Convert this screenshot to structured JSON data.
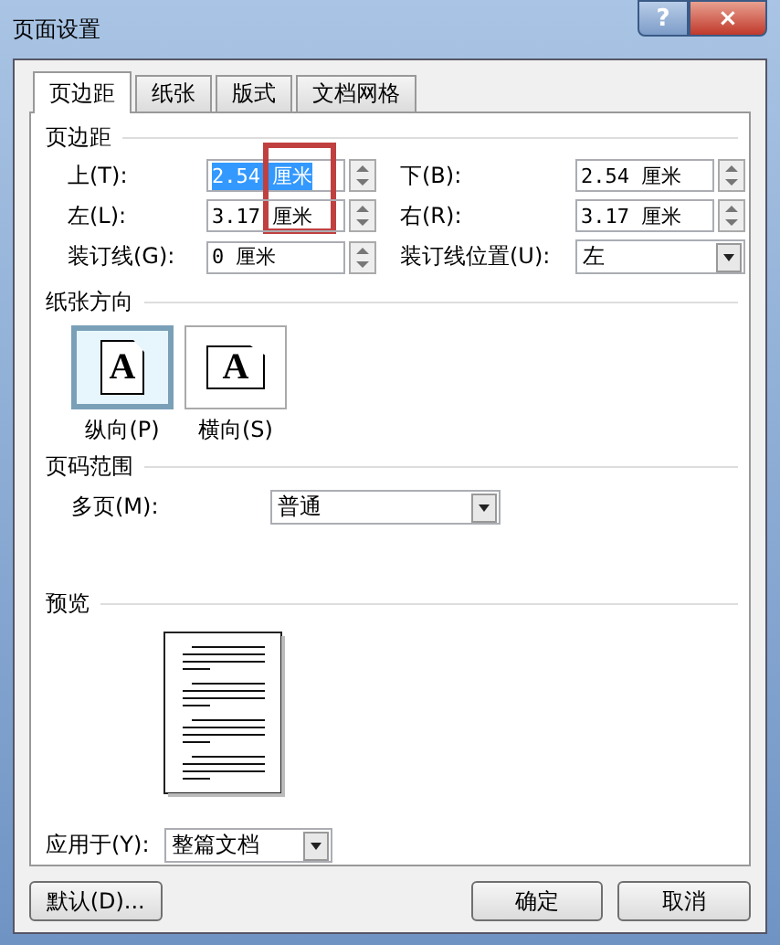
{
  "window": {
    "title": "页面设置",
    "help": "?",
    "close": "×"
  },
  "tabs": [
    {
      "label": "页边距",
      "selected": true
    },
    {
      "label": "纸张",
      "selected": false
    },
    {
      "label": "版式",
      "selected": false
    },
    {
      "label": "文档网格",
      "selected": false
    }
  ],
  "margins": {
    "heading": "页边距",
    "annotation_box": true,
    "fields": [
      {
        "label": "上(T):",
        "value": "2.54 厘米",
        "text_selected": true
      },
      {
        "label": "下(B):",
        "value": "2.54 厘米",
        "text_selected": false
      },
      {
        "label": "左(L):",
        "value": "3.17 厘米",
        "text_selected": false
      },
      {
        "label": "右(R):",
        "value": "3.17 厘米",
        "text_selected": false
      }
    ],
    "gutter": {
      "label": "装订线(G):",
      "value": "0 厘米"
    },
    "gutter_position": {
      "label": "装订线位置(U):",
      "value": "左"
    }
  },
  "orientation": {
    "heading": "纸张方向",
    "options": [
      {
        "label": "纵向(P)",
        "kind": "portrait",
        "glyph": "A",
        "selected": true
      },
      {
        "label": "横向(S)",
        "kind": "landscape",
        "glyph": "A",
        "selected": false
      }
    ]
  },
  "pages": {
    "heading": "页码范围",
    "label": "多页(M):",
    "value": "普通"
  },
  "preview": {
    "heading": "预览",
    "apply_label": "应用于(Y):",
    "apply_value": "整篇文档"
  },
  "buttons": [
    {
      "label": "默认(D)...",
      "kind": "default"
    },
    {
      "label": "确定",
      "kind": "ok"
    },
    {
      "label": "取消",
      "kind": "cancel"
    }
  ]
}
